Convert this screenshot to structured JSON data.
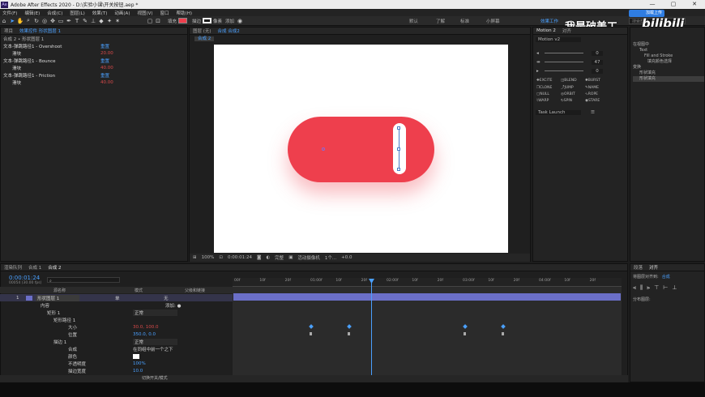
{
  "titlebar": {
    "title": "Adobe After Effects 2020 - D:\\实验小课\\开关按钮.aep *",
    "icon": "Ae",
    "win_min": "—",
    "win_max": "▢",
    "win_close": "✕"
  },
  "menu": [
    "文件(F)",
    "编辑(E)",
    "合成(C)",
    "图层(L)",
    "效果(T)",
    "动画(A)",
    "视图(V)",
    "窗口",
    "帮助(H)"
  ],
  "toolbar": {
    "fill_label": "填充",
    "stroke_label": "描边",
    "stroke_px": "像素",
    "add_label": "添加",
    "workspaces": [
      "默认",
      "了解",
      "标准",
      "小屏幕"
    ],
    "active_workspace": "效果工作",
    "search_placeholder": "搜索帮助"
  },
  "watermark": {
    "text": "我是破美工",
    "brand": "bilibili",
    "badge": "加载上传"
  },
  "left_panel": {
    "tabs": [
      "项目",
      "效果控件 形状图层 1"
    ],
    "breadcrumb": "合成 2 • 形状图层 1",
    "effects": [
      {
        "name": "文本-弹跳路径1 - Overshoot",
        "value": "重置",
        "sub": "滑块",
        "subval": "20.00"
      },
      {
        "name": "文本-弹跳路径1 - Bounce",
        "value": "重置",
        "sub": "滑块",
        "subval": "40.00"
      },
      {
        "name": "文本-弹跳路径1 - Friction",
        "value": "重置",
        "sub": "滑块",
        "subval": "40.00"
      }
    ]
  },
  "viewer": {
    "tabs": [
      "图层 (无)",
      "合成 合成2"
    ],
    "breadcrumb": "合成 2",
    "footer": {
      "zoom": "100%",
      "time": "0:00:01:24",
      "quality": "完整",
      "camera": "活动摄像机",
      "views": "1个...",
      "exposure": "+0.0"
    }
  },
  "motion": {
    "tabs": [
      "Motion 2",
      "对齐"
    ],
    "version": "Motion v2",
    "slider_vals": [
      "0",
      "47",
      "0"
    ],
    "buttons": [
      "EXCITE",
      "BLEND",
      "BURST",
      "CLONE",
      "JUMP",
      "NAME",
      "NULL",
      "ORBIT",
      "ROPE",
      "WARP",
      "SPIN",
      "STARE"
    ],
    "task": "Task Launch"
  },
  "right_panel": {
    "items": [
      "在视图中",
      "Text",
      "Fill and Stroke",
      "填充颜色选择",
      "变换",
      "形状填充",
      "形状填充"
    ],
    "align_tabs": [
      "段落",
      "对齐"
    ],
    "align_to": "将图层对齐到:",
    "align_target": "合成",
    "distribute": "分布图层:"
  },
  "timeline": {
    "tabs": [
      "渲染队列",
      "合成 1",
      "合成 2"
    ],
    "timecode": "0:00:01:24",
    "timecode_sub": "00054 (30.00 fps)",
    "columns": {
      "source": "源名称",
      "mode": "模式",
      "parent": "父级和链接"
    },
    "rows": [
      {
        "num": "1",
        "name": "形状图层 1",
        "mode": "单",
        "parent": "无"
      },
      {
        "name": "内容",
        "mode": "",
        "parent": "添加: ●"
      },
      {
        "name": "矩形 1",
        "mode": "正常",
        "parent": ""
      },
      {
        "name": "矩形路径 1",
        "mode": "",
        "parent": ""
      },
      {
        "name": "大小",
        "value": "30.0, 100.0"
      },
      {
        "name": "位置",
        "value": "350.0, 0.0"
      },
      {
        "name": "描边 1",
        "mode": "正常",
        "parent": ""
      },
      {
        "name": "合成",
        "value": "在同组中前一个之下"
      },
      {
        "name": "颜色",
        "value": ""
      },
      {
        "name": "不透明度",
        "value": "100%"
      },
      {
        "name": "描边宽度",
        "value": "10.0"
      }
    ],
    "ruler": [
      "00f",
      "10f",
      "20f",
      "01:00f",
      "10f",
      "20f",
      "02:00f",
      "10f",
      "20f",
      "03:00f",
      "10f",
      "20f",
      "04:00f",
      "10f",
      "20f"
    ],
    "footer": "切换开关/模式"
  },
  "colors": {
    "accent": "#4aa0ff",
    "pill": "#ee3f4d",
    "layer_bar": "#6b6fc8"
  }
}
